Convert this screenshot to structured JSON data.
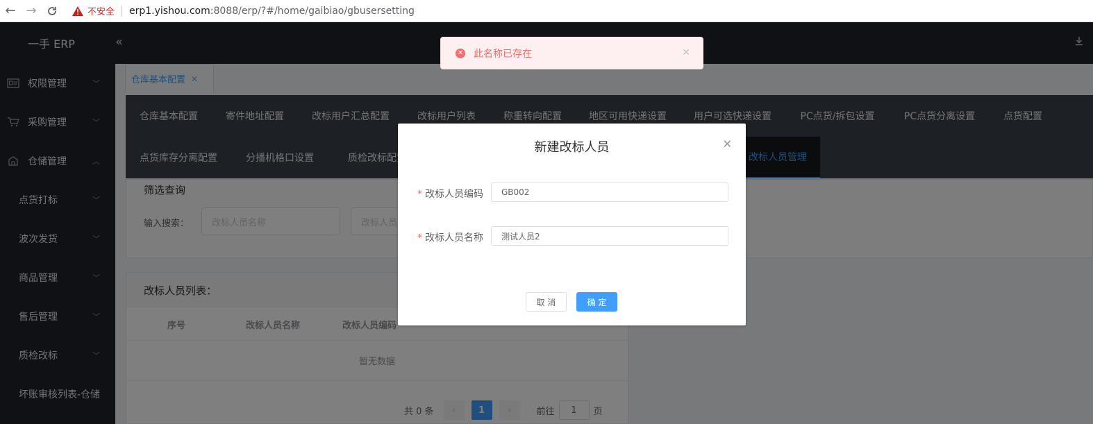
{
  "browser": {
    "security_label": "不安全",
    "url_host": "erp1.yishou.com",
    "url_path": ":8088/erp/?#/home/gaibiao/gbusersetting"
  },
  "sidebar": {
    "logo": "一手 ERP",
    "items": [
      {
        "label": "权限管理"
      },
      {
        "label": "采购管理"
      },
      {
        "label": "仓储管理"
      },
      {
        "label": "点货打标"
      },
      {
        "label": "波次发货"
      },
      {
        "label": "商品管理"
      },
      {
        "label": "售后管理"
      },
      {
        "label": "质检改标"
      },
      {
        "label": "坏账审核列表-仓储"
      }
    ]
  },
  "tabs": [
    {
      "label": "仓库基本配置"
    }
  ],
  "submenu": {
    "row1": [
      "仓库基本配置",
      "寄件地址配置",
      "改标用户汇总配置",
      "改标用户列表",
      "称重转向配置",
      "地区可用快递设置",
      "用户可选快递设置",
      "PC点货/拆包设置",
      "PC点货分离设置",
      "点货配置"
    ],
    "row2": [
      "点货库存分离配置",
      "分播机格口设置",
      "质检改标配置",
      "改标人员管理"
    ]
  },
  "filter": {
    "title": "筛选查询",
    "label": "输入搜索：",
    "placeholder_name": "改标人员名称",
    "placeholder_code": "改标人员"
  },
  "list": {
    "title": "改标人员列表：",
    "columns": [
      "序号",
      "改标人员名称",
      "改标人员编码"
    ],
    "empty": "暂无数据"
  },
  "pager": {
    "total": "共 0 条",
    "current": "1",
    "goto": "前往",
    "page_input": "1",
    "page_unit": "页"
  },
  "toast": {
    "message": "此名称已存在"
  },
  "dialog": {
    "title": "新建改标人员",
    "code_label": "改标人员编码",
    "code_value": "GB002",
    "name_label": "改标人员名称",
    "name_value": "测试人员2",
    "cancel": "取 消",
    "ok": "确 定"
  }
}
